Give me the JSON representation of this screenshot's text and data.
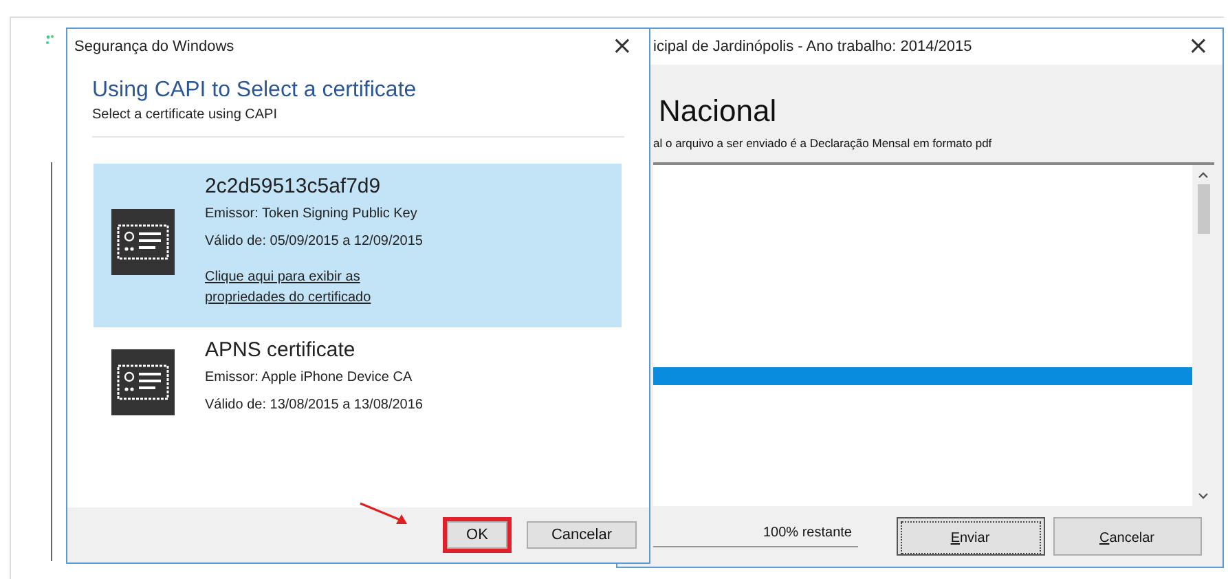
{
  "back_window": {
    "title": "icipal de Jardinópolis - Ano trabalho: 2014/2015",
    "close": "×",
    "heading": "Nacional",
    "description": "al o arquivo a ser enviado é a Declaração Mensal em formato pdf",
    "listbox": {
      "rows": [
        {
          "selected": false
        },
        {
          "selected": false
        },
        {
          "selected": true
        },
        {
          "selected": false
        }
      ]
    },
    "status": "100% restante",
    "buttons": [
      {
        "label": "Enviar",
        "default": true
      },
      {
        "label": "Cancelar",
        "default": false
      }
    ]
  },
  "dialog": {
    "title": "Segurança do Windows",
    "close": "×",
    "heading": "Using CAPI to Select a certificate",
    "subheading": "Select a certificate using CAPI",
    "certificates": [
      {
        "name": "2c2d59513c5af7d9",
        "issuer": "Emissor: Token Signing Public Key",
        "validity": "Válido de: 05/09/2015 a 12/09/2015",
        "link": "Clique aqui para exibir as propriedades do certificado",
        "selected": true
      },
      {
        "name": "APNS certificate",
        "issuer": "Emissor: Apple iPhone Device CA",
        "validity": "Válido de: 13/08/2015 a 13/08/2016",
        "selected": false
      }
    ],
    "buttons": [
      {
        "label": "OK",
        "highlighted": true
      },
      {
        "label": "Cancelar",
        "highlighted": false
      }
    ]
  }
}
